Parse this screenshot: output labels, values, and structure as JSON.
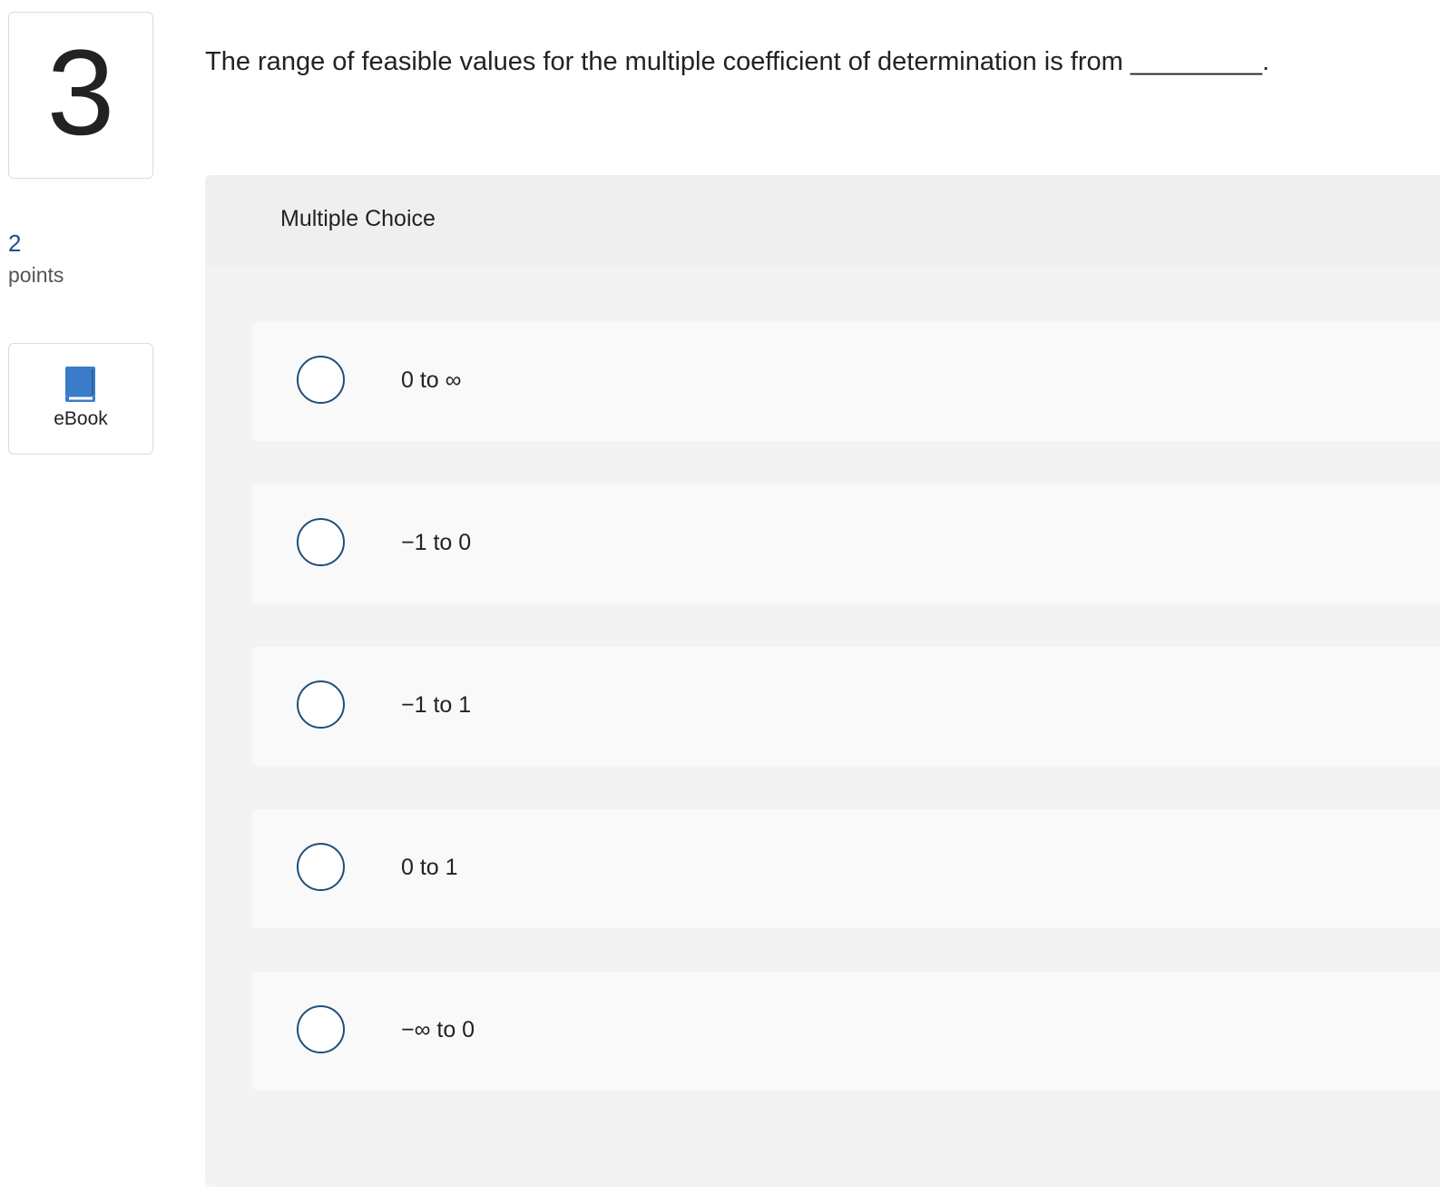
{
  "question": {
    "number": "3",
    "points_value": "2",
    "points_label": "points",
    "text": "The range of feasible values for the multiple coefficient of determination is from _________."
  },
  "ebook": {
    "label": "eBook",
    "icon": "book-icon",
    "icon_color": "#3a7cc7"
  },
  "answer_panel": {
    "title": "Multiple Choice",
    "options": [
      {
        "label": "0 to ∞"
      },
      {
        "label": "−1 to 0"
      },
      {
        "label": "−1 to 1"
      },
      {
        "label": "0 to 1"
      },
      {
        "label": "−∞ to 0"
      }
    ]
  },
  "colors": {
    "accent": "#1f4e7a",
    "points": "#1f4e8c",
    "panel_bg": "#f3f3f3",
    "option_bg": "#f9f9f9"
  }
}
